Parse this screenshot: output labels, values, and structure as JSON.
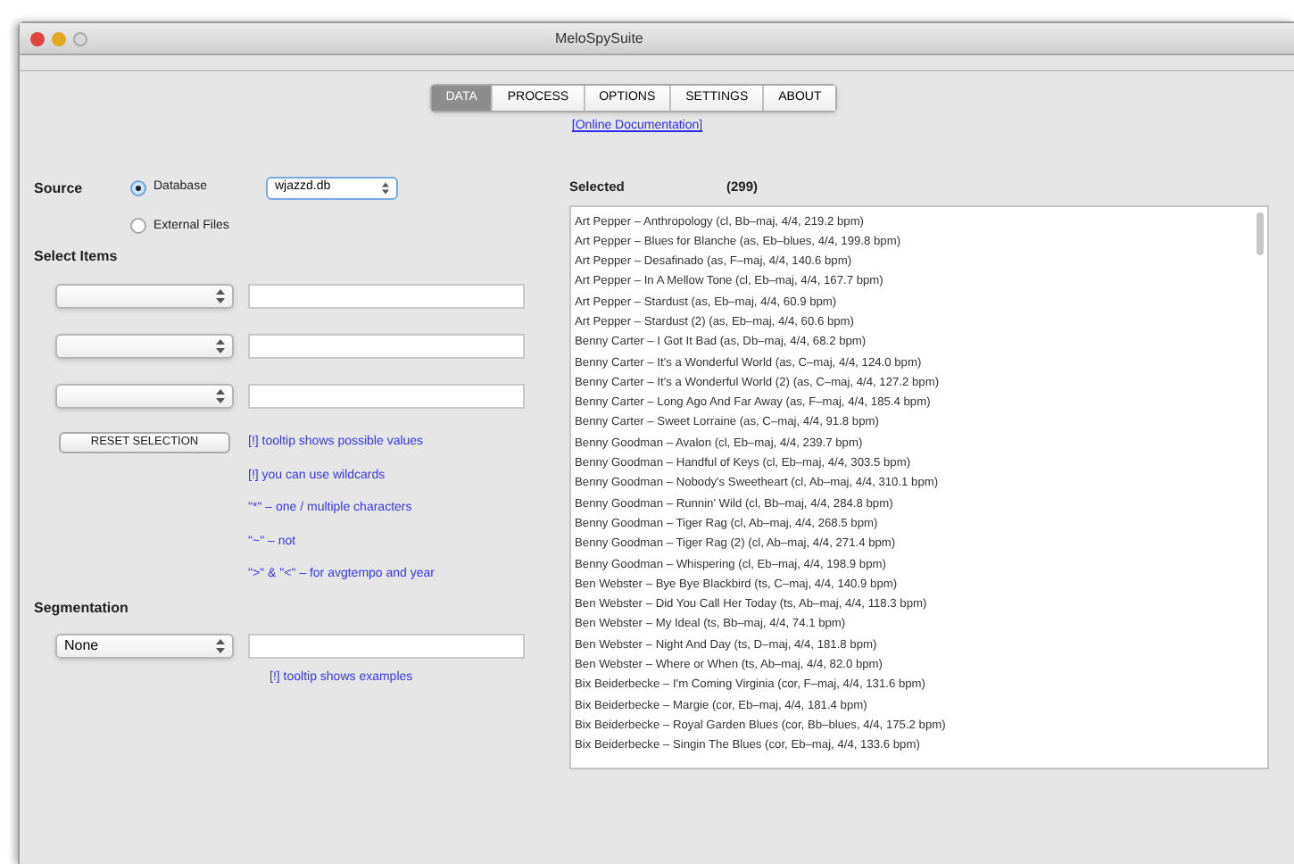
{
  "window": {
    "title": "MeloSpySuite"
  },
  "tabs": [
    {
      "label": "DATA",
      "selected": true
    },
    {
      "label": "PROCESS",
      "selected": false
    },
    {
      "label": "OPTIONS",
      "selected": false
    },
    {
      "label": "SETTINGS",
      "selected": false
    },
    {
      "label": "ABOUT",
      "selected": false
    }
  ],
  "doc_link": "[Online Documentation]",
  "source": {
    "label": "Source",
    "options": [
      {
        "label": "Database",
        "selected": true
      },
      {
        "label": "External Files",
        "selected": false
      }
    ],
    "database": "wjazzd.db"
  },
  "select_items": {
    "label": "Select Items"
  },
  "reset_button": "RESET SELECTION",
  "hints": [
    "[!] tooltip shows possible values",
    "[!] you can use wildcards",
    "\"*\" – one / multiple characters",
    "\"~\" – not",
    "\">\" & \"<\" – for avgtempo and year"
  ],
  "segmentation": {
    "label": "Segmentation",
    "value": "None",
    "hint": "[!] tooltip shows examples"
  },
  "selected": {
    "label": "Selected",
    "count": "(299)",
    "items": [
      "Art Pepper – Anthropology (cl, Bb–maj, 4/4, 219.2 bpm)",
      "Art Pepper – Blues for Blanche (as, Eb–blues, 4/4, 199.8 bpm)",
      "Art Pepper – Desafinado (as, F–maj, 4/4, 140.6 bpm)",
      "Art Pepper – In A Mellow Tone (cl, Eb–maj, 4/4, 167.7 bpm)",
      "Art Pepper – Stardust (as, Eb–maj, 4/4, 60.9 bpm)",
      "Art Pepper – Stardust (2) (as, Eb–maj, 4/4, 60.6 bpm)",
      "Benny Carter – I Got It Bad (as, Db–maj, 4/4, 68.2 bpm)",
      "Benny Carter – It's a Wonderful World (as, C–maj, 4/4, 124.0 bpm)",
      "Benny Carter – It's a Wonderful World (2) (as, C–maj, 4/4, 127.2 bpm)",
      "Benny Carter – Long Ago And Far Away (as, F–maj, 4/4, 185.4 bpm)",
      "Benny Carter – Sweet Lorraine (as, C–maj, 4/4, 91.8 bpm)",
      "Benny Goodman – Avalon (cl, Eb–maj, 4/4, 239.7 bpm)",
      "Benny Goodman – Handful of Keys (cl, Eb–maj, 4/4, 303.5 bpm)",
      "Benny Goodman – Nobody's Sweetheart (cl, Ab–maj, 4/4, 310.1 bpm)",
      "Benny Goodman – Runnin' Wild (cl, Bb–maj, 4/4, 284.8 bpm)",
      "Benny Goodman – Tiger Rag (cl, Ab–maj, 4/4, 268.5 bpm)",
      "Benny Goodman – Tiger Rag (2) (cl, Ab–maj, 4/4, 271.4 bpm)",
      "Benny Goodman – Whispering (cl, Eb–maj, 4/4, 198.9 bpm)",
      "Ben Webster – Bye Bye Blackbird (ts, C–maj, 4/4, 140.9 bpm)",
      "Ben Webster – Did You Call Her Today (ts, Ab–maj, 4/4, 118.3 bpm)",
      "Ben Webster – My Ideal (ts, Bb–maj, 4/4, 74.1 bpm)",
      "Ben Webster – Night And Day (ts, D–maj, 4/4, 181.8 bpm)",
      "Ben Webster – Where or When (ts, Ab–maj, 4/4, 82.0 bpm)",
      "Bix Beiderbecke – I'm Coming Virginia (cor, F–maj, 4/4, 131.6 bpm)",
      "Bix Beiderbecke – Margie (cor, Eb–maj, 4/4, 181.4 bpm)",
      "Bix Beiderbecke – Royal Garden Blues (cor, Bb–blues, 4/4, 175.2 bpm)",
      "Bix Beiderbecke – Singin The Blues (cor, Eb–maj, 4/4, 133.6 bpm)"
    ]
  }
}
